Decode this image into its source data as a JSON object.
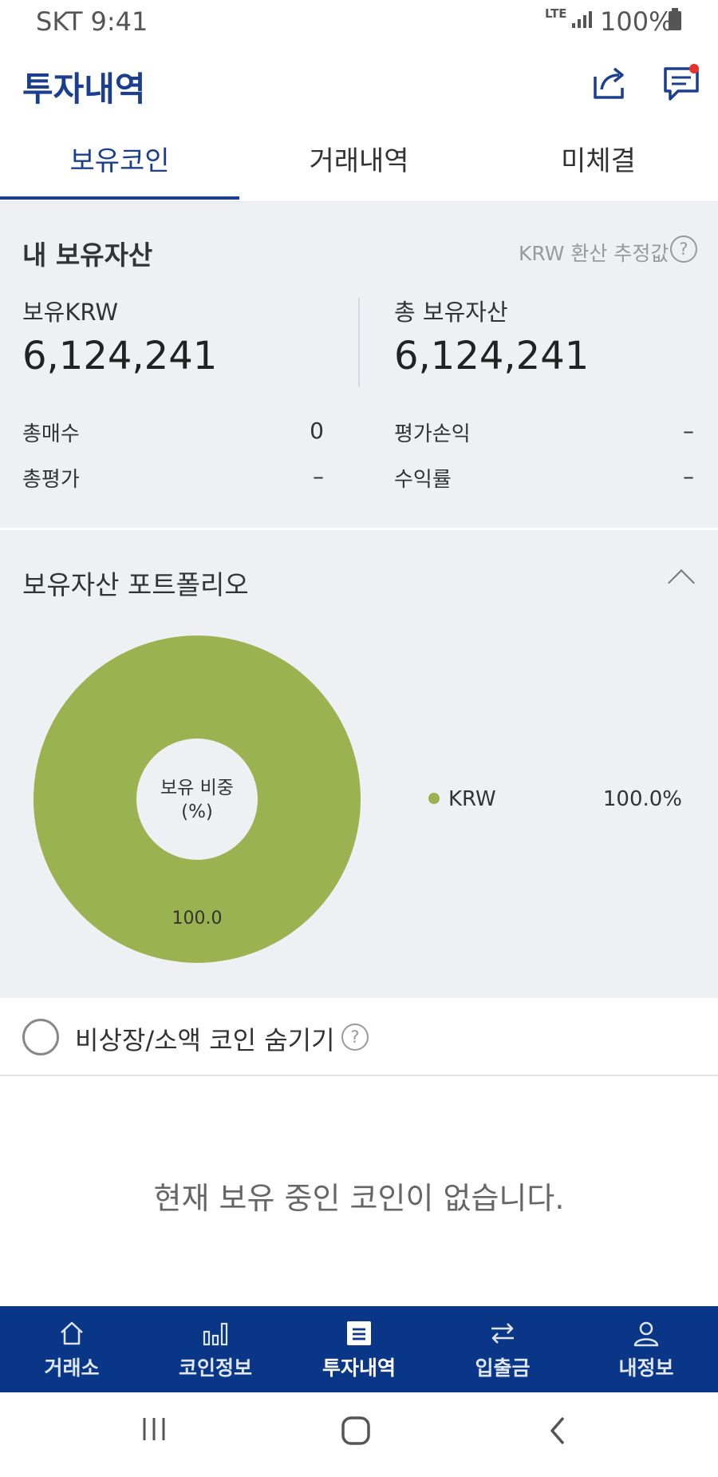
{
  "status_bar": {
    "carrier_time": "SKT 9:41",
    "network": "LTE",
    "battery": "100%"
  },
  "header": {
    "title": "투자내역",
    "share_icon": "share-icon",
    "chat_icon": "chat-icon"
  },
  "tabs": [
    {
      "label": "보유코인",
      "active": true
    },
    {
      "label": "거래내역",
      "active": false
    },
    {
      "label": "미체결",
      "active": false
    }
  ],
  "assets": {
    "section_title": "내 보유자산",
    "krw_note": "KRW 환산 추정값",
    "held_krw_label": "보유KRW",
    "held_krw_value": "6,124,241",
    "total_label": "총 보유자산",
    "total_value": "6,124,241",
    "stats": [
      {
        "label": "총매수",
        "value": "0"
      },
      {
        "label": "평가손익",
        "value": "–"
      },
      {
        "label": "총평가",
        "value": "–"
      },
      {
        "label": "수익률",
        "value": "–"
      }
    ]
  },
  "portfolio": {
    "section_title": "보유자산 포트폴리오",
    "center_label_line1": "보유 비중",
    "center_label_line2": "(%)",
    "colors": {
      "krw": "#9ab250"
    },
    "legend": [
      {
        "name": "KRW",
        "percent": "100.0%"
      }
    ]
  },
  "chart_data": {
    "type": "pie",
    "categories": [
      "KRW"
    ],
    "values": [
      100.0
    ],
    "data_labels": [
      "100.0"
    ],
    "title": "",
    "donut": true
  },
  "filter": {
    "hide_label": "비상장/소액 코인 숨기기"
  },
  "empty_message": "현재 보유 중인 코인이 없습니다.",
  "bottom_nav": [
    {
      "label": "거래소",
      "icon": "home-icon",
      "active": false
    },
    {
      "label": "코인정보",
      "icon": "bar-chart-icon",
      "active": false
    },
    {
      "label": "투자내역",
      "icon": "list-icon",
      "active": true
    },
    {
      "label": "입출금",
      "icon": "transfer-icon",
      "active": false
    },
    {
      "label": "내정보",
      "icon": "user-icon",
      "active": false
    }
  ],
  "theme": {
    "brand": "#1b3f8e",
    "nav_bg": "#093687",
    "section_bg": "#eef0f4",
    "notification": "#e8322d"
  }
}
